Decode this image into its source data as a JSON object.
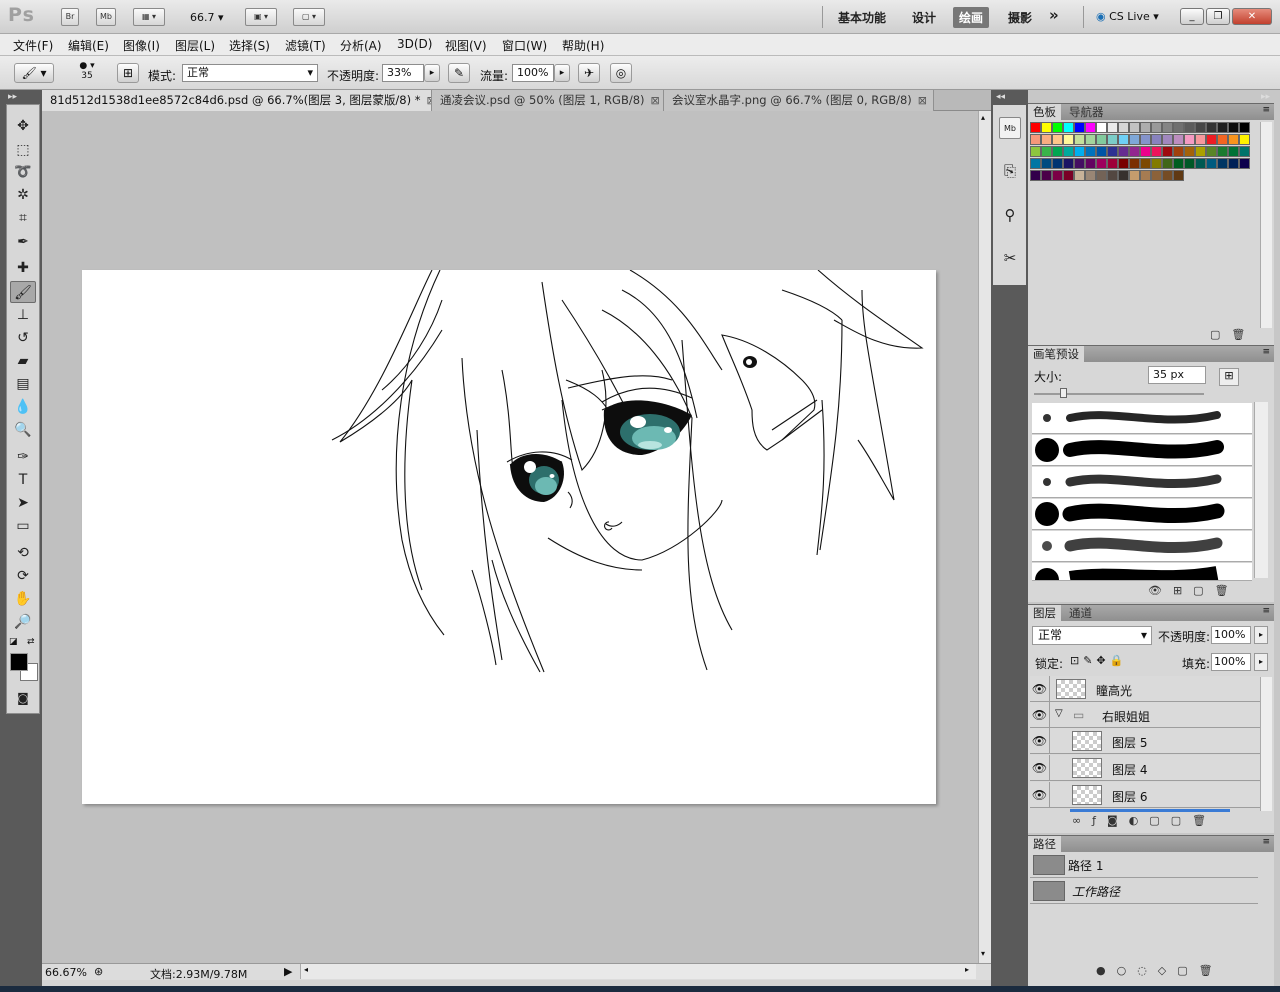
{
  "appbar": {
    "logo": "Ps",
    "br_label": "Br",
    "mb_label": "Mb",
    "zoom_value": "66.7",
    "workspaces": [
      "基本功能",
      "设计",
      "绘画",
      "摄影"
    ],
    "active_workspace": "绘画",
    "more": "»",
    "cslive": "CS Live"
  },
  "menu": [
    "文件(F)",
    "编辑(E)",
    "图像(I)",
    "图层(L)",
    "选择(S)",
    "滤镜(T)",
    "分析(A)",
    "3D(D)",
    "视图(V)",
    "窗口(W)",
    "帮助(H)"
  ],
  "options": {
    "brush_size": "35",
    "mode_label": "模式:",
    "mode_value": "正常",
    "opacity_label": "不透明度:",
    "opacity_value": "33%",
    "flow_label": "流量:",
    "flow_value": "100%"
  },
  "tabs": [
    {
      "label": "81d512d1538d1ee8572c84d6.psd @ 66.7%(图层 3, 图层蒙版/8) *",
      "active": true
    },
    {
      "label": "通凌会议.psd @ 50% (图层 1, RGB/8)",
      "active": false
    },
    {
      "label": "会议室水晶字.png @ 66.7% (图层 0, RGB/8)",
      "active": false
    }
  ],
  "status": {
    "zoom": "66.67%",
    "doc": "文档:2.93M/9.78M"
  },
  "swatches_panel": {
    "tabs": [
      "色板",
      "导航器"
    ],
    "colors": [
      "#ff0000",
      "#ffff00",
      "#00ff00",
      "#00ffff",
      "#0000ff",
      "#ff00ff",
      "#ffffff",
      "#ebebeb",
      "#d6d6d6",
      "#c2c2c2",
      "#adadad",
      "#999999",
      "#858585",
      "#707070",
      "#5c5c5c",
      "#474747",
      "#333333",
      "#1f1f1f",
      "#0a0a0a",
      "#000000",
      "#f7977a",
      "#f9ad81",
      "#fdc68a",
      "#fff79a",
      "#c4df9b",
      "#a3d39c",
      "#82ca9d",
      "#7bcdc8",
      "#6ecff6",
      "#7ea7d8",
      "#8493ca",
      "#8882be",
      "#a187be",
      "#bc8dbf",
      "#f49ac2",
      "#f6989d",
      "#ed1c24",
      "#f26522",
      "#f7941d",
      "#fff200",
      "#8dc63f",
      "#39b54a",
      "#00a651",
      "#00a99d",
      "#00aeef",
      "#0072bc",
      "#0054a6",
      "#2e3192",
      "#662d91",
      "#92278f",
      "#ec008c",
      "#ed145b",
      "#9e0b0f",
      "#a0410d",
      "#a36209",
      "#aba000",
      "#598527",
      "#1a7b30",
      "#007236",
      "#00746b",
      "#0076a3",
      "#004b80",
      "#003471",
      "#1b1464",
      "#440e62",
      "#630460",
      "#9e005d",
      "#9e0039",
      "#790000",
      "#7b2e00",
      "#7d4900",
      "#827b00",
      "#406618",
      "#005e20",
      "#005826",
      "#005952",
      "#005b7f",
      "#003663",
      "#002157",
      "#0d004c",
      "#32004b",
      "#4b0049",
      "#7b0046",
      "#7a0026",
      "#c7b299",
      "#998675",
      "#736357",
      "#534741",
      "#37302d",
      "#c69c6d",
      "#a67c52",
      "#8c6239",
      "#754c24",
      "#603913"
    ]
  },
  "brush_panel": {
    "tabs": [
      "画笔预设"
    ],
    "size_label": "大小:",
    "size_value": "35 px"
  },
  "layers_panel": {
    "tabs": [
      "图层",
      "通道"
    ],
    "blend_mode": "正常",
    "opacity_label": "不透明度:",
    "opacity_value": "100%",
    "lock_label": "锁定:",
    "fill_label": "填充:",
    "fill_value": "100%",
    "layers": [
      {
        "name": "瞳高光",
        "type": "layer",
        "indent": false
      },
      {
        "name": "右眼姐姐",
        "type": "group",
        "indent": false
      },
      {
        "name": "图层 5",
        "type": "layer",
        "indent": true
      },
      {
        "name": "图层 4",
        "type": "layer",
        "indent": true
      },
      {
        "name": "图层 6",
        "type": "layer",
        "indent": true
      }
    ]
  },
  "paths_panel": {
    "tabs": [
      "路径"
    ],
    "paths": [
      "路径 1",
      "工作路径"
    ]
  }
}
